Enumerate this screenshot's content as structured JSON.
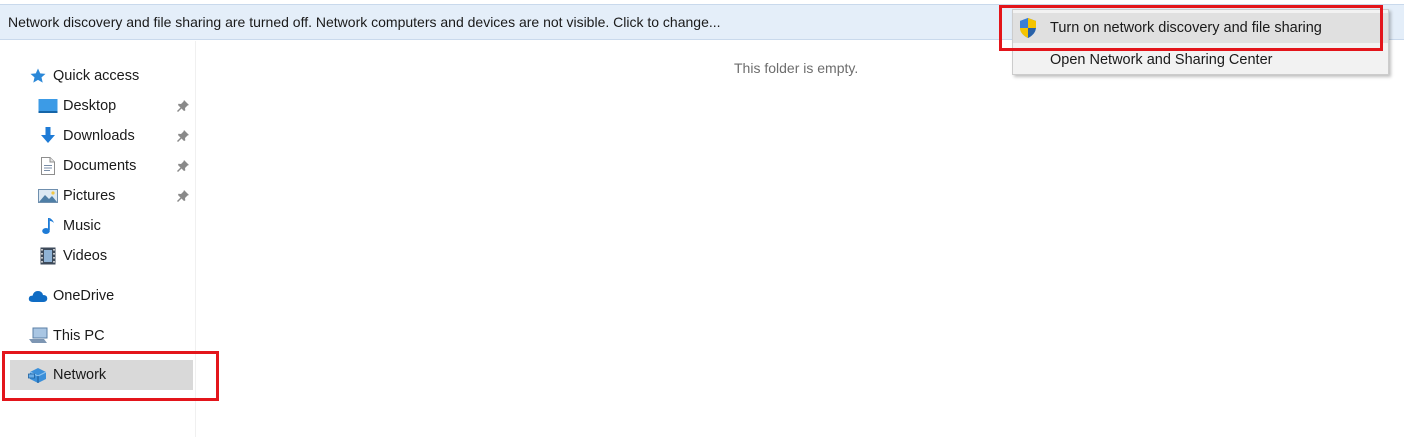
{
  "infobar": {
    "text": "Network discovery and file sharing are turned off. Network computers and devices are not visible. Click to change..."
  },
  "sidebar": {
    "quick_access": {
      "label": "Quick access",
      "icon": "star-icon"
    },
    "items": [
      {
        "label": "Desktop",
        "icon": "desktop-icon",
        "pinned": true
      },
      {
        "label": "Downloads",
        "icon": "download-icon",
        "pinned": true
      },
      {
        "label": "Documents",
        "icon": "document-icon",
        "pinned": true
      },
      {
        "label": "Pictures",
        "icon": "pictures-icon",
        "pinned": true
      },
      {
        "label": "Music",
        "icon": "music-icon",
        "pinned": false
      },
      {
        "label": "Videos",
        "icon": "video-icon",
        "pinned": false
      }
    ],
    "onedrive": {
      "label": "OneDrive",
      "icon": "cloud-icon"
    },
    "this_pc": {
      "label": "This PC",
      "icon": "computer-icon"
    },
    "network": {
      "label": "Network",
      "icon": "network-icon",
      "selected": true
    }
  },
  "main": {
    "empty_message": "This folder is empty."
  },
  "context_menu": {
    "items": [
      {
        "label": "Turn on network discovery and file sharing",
        "icon": "shield-icon",
        "hovered": true
      },
      {
        "label": "Open Network and Sharing Center"
      }
    ]
  },
  "colors": {
    "infobar_bg": "#e4eef9",
    "highlight": "#e3151b",
    "selected_bg": "#d9d9d9",
    "accent": "#1e7bd6"
  }
}
